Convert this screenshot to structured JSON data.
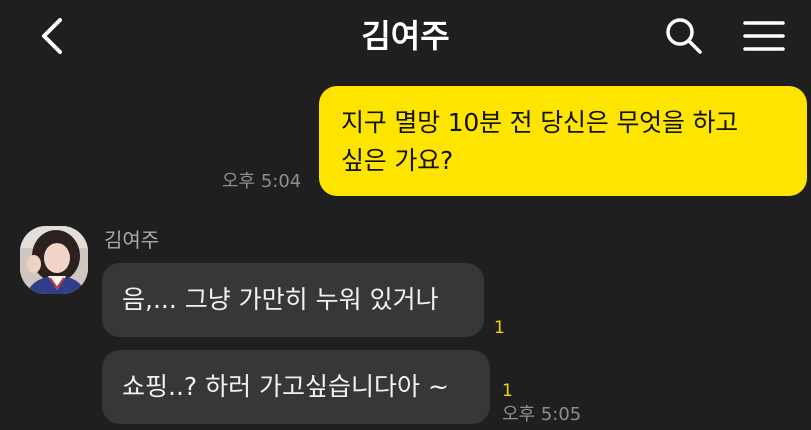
{
  "header": {
    "title": "김여주",
    "icons": {
      "back": "back-chevron-icon",
      "search": "search-icon",
      "menu": "hamburger-menu-icon"
    }
  },
  "messages": {
    "outgoing": [
      {
        "line1": "지구 멸망 10분 전 당신은 무엇을 하고",
        "line2": "싶은 가요?",
        "time": "오후 5:04"
      }
    ],
    "incoming": {
      "sender": "김여주",
      "items": [
        {
          "text": "음,... 그냥 가만히 누워 있거나",
          "unread": "1"
        },
        {
          "text": "쇼핑..? 하러 가고싶습니다아 ~",
          "unread": "1"
        }
      ],
      "time": "오후 5:05"
    }
  },
  "colors": {
    "background": "#1f1f1f",
    "outgoing_bubble": "#fde500",
    "incoming_bubble": "#373737",
    "unread_count": "#f2d400"
  }
}
